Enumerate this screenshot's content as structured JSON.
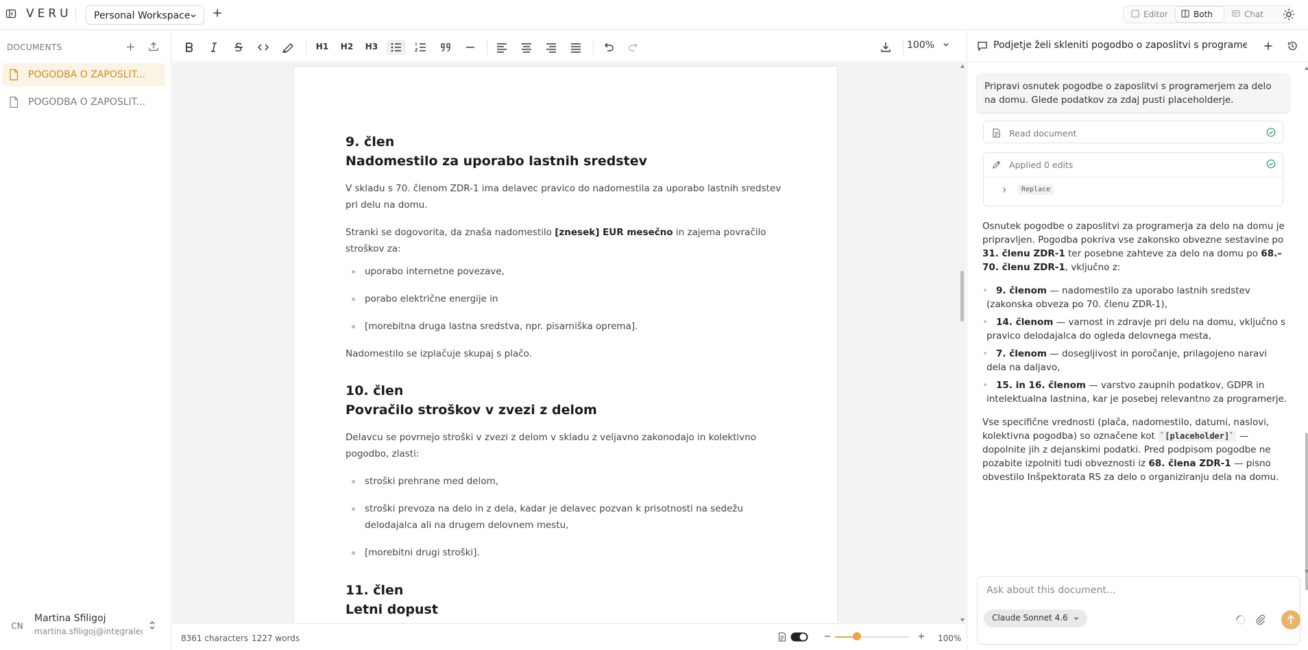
{
  "app": {
    "logo": "VERU",
    "workspace": "Personal Workspace",
    "view_modes": [
      "Editor",
      "Both",
      "Chat"
    ],
    "active_view": "Both"
  },
  "sidebar": {
    "header": "DOCUMENTS",
    "documents": [
      {
        "label": "POGODBA O ZAPOSLIT...",
        "active": true
      },
      {
        "label": "POGODBA O ZAPOSLIT...",
        "active": false
      }
    ],
    "user": {
      "initials": "CN",
      "name": "Martina Sfiligoj",
      "email": "martina.sfiligoj@integraleg..."
    }
  },
  "toolbar": {
    "h1": "H1",
    "h2": "H2",
    "h3": "H3",
    "zoom": "100%"
  },
  "document": {
    "sections": [
      {
        "number": "9. člen",
        "title": "Nadomestilo za uporabo lastnih sredstev",
        "p1": "V skladu s 70. členom ZDR-1 ima delavec pravico do nadomestila za uporabo lastnih sredstev pri delu na domu.",
        "p2_before": "Stranki se dogovorita, da znaša nadomestilo ",
        "p2_bold": "[znesek] EUR mesečno",
        "p2_after": " in zajema povračilo stroškov za:",
        "items": [
          "uporabo internetne povezave,",
          "porabo električne energije in",
          "[morebitna druga lastna sredstva, npr. pisarniška oprema]."
        ],
        "p3": "Nadomestilo se izplačuje skupaj s plačo."
      },
      {
        "number": "10. člen",
        "title": "Povračilo stroškov v zvezi z delom",
        "p1": "Delavcu se povrnejo stroški v zvezi z delom v skladu z veljavno zakonodajo in kolektivno pogodbo, zlasti:",
        "items": [
          "stroški prehrane med delom,",
          "stroški prevoza na delo in z dela, kadar je delavec pozvan k prisotnosti na sedežu delodajalca ali na drugem delovnem mestu,",
          "[morebitni drugi stroški]."
        ]
      },
      {
        "number": "11. člen",
        "title": "Letni dopust"
      }
    ]
  },
  "status": {
    "characters": "8361 characters",
    "words": "1227 words",
    "zoom": "100%",
    "zoom_level": 0.3
  },
  "chat": {
    "title": "Podjetje želi skleniti pogodbo o zaposlitvi s programerje...",
    "user_message": "Pripravi osnutek pogodbe o zaposlitvi s programerjem za delo na domu. Glede podatkov za zdaj pusti placeholderje.",
    "tools": [
      {
        "label": "Read document",
        "status": "done"
      },
      {
        "label": "Applied 0 edits",
        "status": "done",
        "sub": "Replace"
      }
    ],
    "reply": {
      "intro_1": "Osnutek pogodbe o zaposlitvi za programerja za delo na domu je pripravljen. Pogodba pokriva vse zakonsko obvezne sestavine po ",
      "intro_b1": "31. členu ZDR-1",
      "intro_2": " ter posebne zahteve za delo na domu po ",
      "intro_b2": "68.–70. členu ZDR-1",
      "intro_3": ", vključno z:",
      "bullets": [
        {
          "bold": "9. členom",
          "text": " — nadomestilo za uporabo lastnih sredstev (zakonska obveza po 70. členu ZDR-1),"
        },
        {
          "bold": "14. členom",
          "text": " — varnost in zdravje pri delu na domu, vključno s pravico delodajalca do ogleda delovnega mesta,"
        },
        {
          "bold": "7. členom",
          "text": " — dosegljivost in poročanje, prilagojeno naravi dela na daljavo,"
        },
        {
          "bold": "15. in 16. členom",
          "text": " — varstvo zaupnih podatkov, GDPR in intelektualna lastnina, kar je posebej relevantno za programerje."
        }
      ],
      "outro_1": "Vse specifične vrednosti (plača, nadomestilo, datumi, naslovi, kolektivna pogodba) so označene kot ",
      "outro_code": "`[placeholder]`",
      "outro_2": " — dopolnite jih z dejanskimi podatki. Pred podpisom pogodbe ne pozabite izpolniti tudi obveznosti iz ",
      "outro_b": "68. člena ZDR-1",
      "outro_3": " — pisno obvestilo Inšpektorata RS za delo o organiziranju dela na domu."
    },
    "input_placeholder": "Ask about this document...",
    "model": "Claude Sonnet 4.6"
  },
  "colors": {
    "accent": "#c8901f",
    "accent_bg": "#fbf3e6",
    "send_button": "#e8b46b",
    "success": "#2e9d6a"
  }
}
